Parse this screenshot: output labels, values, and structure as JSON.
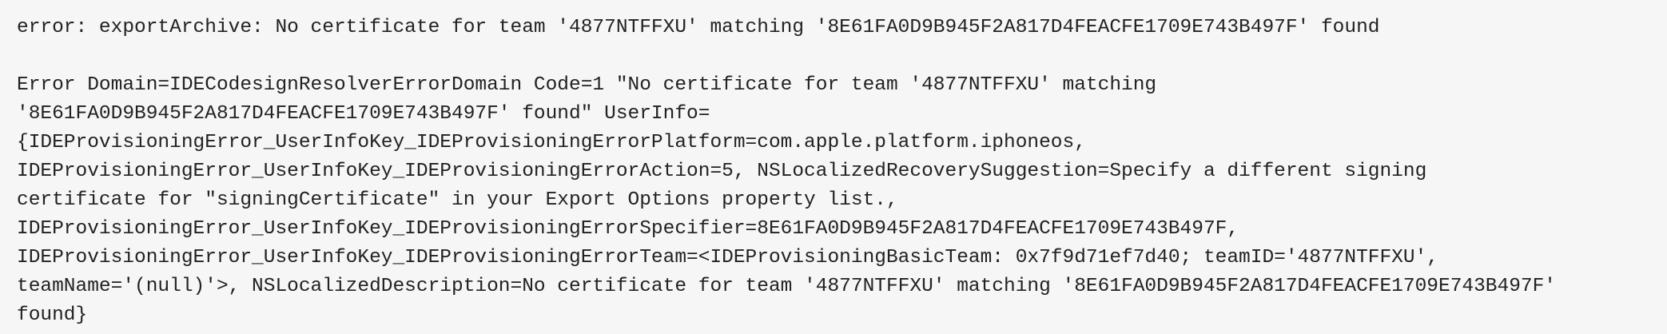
{
  "error_output": {
    "summary_line": "error: exportArchive: No certificate for team '4877NTFFXU' matching '8E61FA0D9B945F2A817D4FEACFE1709E743B497F' found",
    "detail_lines": [
      "Error Domain=IDECodesignResolverErrorDomain Code=1 \"No certificate for team '4877NTFFXU' matching",
      "'8E61FA0D9B945F2A817D4FEACFE1709E743B497F' found\" UserInfo=",
      "{IDEProvisioningError_UserInfoKey_IDEProvisioningErrorPlatform=com.apple.platform.iphoneos,",
      "IDEProvisioningError_UserInfoKey_IDEProvisioningErrorAction=5, NSLocalizedRecoverySuggestion=Specify a different signing",
      "certificate for \"signingCertificate\" in your Export Options property list.,",
      "IDEProvisioningError_UserInfoKey_IDEProvisioningErrorSpecifier=8E61FA0D9B945F2A817D4FEACFE1709E743B497F,",
      "IDEProvisioningError_UserInfoKey_IDEProvisioningErrorTeam=<IDEProvisioningBasicTeam: 0x7f9d71ef7d40; teamID='4877NTFFXU',",
      "teamName='(null)'>, NSLocalizedDescription=No certificate for team '4877NTFFXU' matching '8E61FA0D9B945F2A817D4FEACFE1709E743B497F'",
      "found}"
    ]
  },
  "colors": {
    "background": "#f6f6f6",
    "text": "#222222"
  }
}
